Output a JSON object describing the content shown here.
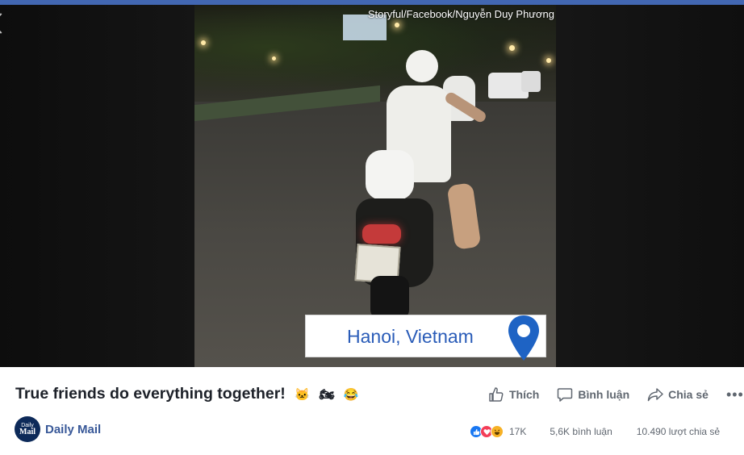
{
  "video": {
    "watermark": "Storyful/Facebook/Nguyễn Duy Phương",
    "location": "Hanoi, Vietnam"
  },
  "post": {
    "caption": "True friends do everything together!",
    "emojis": [
      "🐱",
      "🏍",
      "😂"
    ],
    "page_name": "Daily Mail",
    "avatar_line1": "Daily",
    "avatar_line2": "Mail"
  },
  "actions": {
    "like": "Thích",
    "comment": "Bình luận",
    "share": "Chia sẻ",
    "more": "•••"
  },
  "stats": {
    "reactions": "17K",
    "comments": "5,6K bình luận",
    "shares": "10.490 lượt chia sẻ"
  },
  "colors": {
    "brand": "#4267b2",
    "link": "#385898",
    "location_text": "#2a5cb8",
    "pin": "#1e63c4"
  }
}
